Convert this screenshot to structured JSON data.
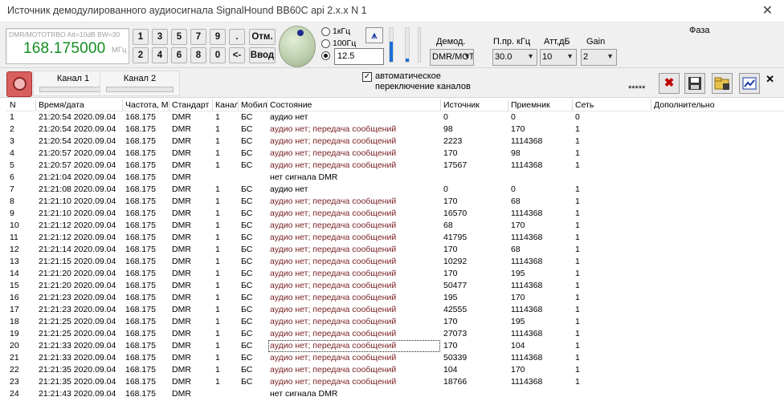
{
  "window": {
    "title": "Источник демодулированного аудиосигнала SignalHound BB60C api 2.x.x N 1",
    "close_glyph": "✕"
  },
  "frequency": {
    "mode_text": "DMR/MOTOTRBO Att=10dB BW=30",
    "value": "168.175000",
    "unit": "МГц"
  },
  "keypad": {
    "row1": [
      "1",
      "3",
      "5",
      "7",
      "9",
      "."
    ],
    "row2": [
      "2",
      "4",
      "6",
      "8",
      "0",
      "<-"
    ],
    "cancel": "Отм.",
    "enter": "Ввод"
  },
  "step": {
    "options": [
      "1кГц",
      "100Гц"
    ],
    "custom_value": "12.5",
    "selected": "custom"
  },
  "antenna_icon": "antenna-icon",
  "level_sliders": {
    "left_level": 0.6,
    "right_level": 0.1
  },
  "settings": {
    "demod_label": "Демод.",
    "demod_value": "DMR/MOTOTRBO",
    "bw_label": "П.пр. кГц",
    "bw_value": "30.0",
    "att_label": "Атт,дБ",
    "att_value": "10",
    "gain_label": "Gain",
    "gain_value": "2",
    "phase_label": "Фаза"
  },
  "channels": {
    "tabs": [
      "Канал 1",
      "Канал 2"
    ],
    "auto_switch_checked": true,
    "auto_switch_label_line1": "автоматическое",
    "auto_switch_label_line2": "переключение каналов",
    "stars": "*****",
    "close_glyph": "✕"
  },
  "table": {
    "columns": [
      "N",
      "Время/дата",
      "Частота, М",
      "Стандарт",
      "Канал",
      "Мобил",
      "Состояние",
      "Источник",
      "Приемник",
      "Сеть",
      "Дополнительно"
    ],
    "rows": [
      [
        "1",
        "21:20:54 2020.09.04",
        "168.175",
        "DMR",
        "1",
        "БС",
        "аудио нет",
        "0",
        "0",
        "0",
        ""
      ],
      [
        "2",
        "21:20:54 2020.09.04",
        "168.175",
        "DMR",
        "1",
        "БС",
        "аудио нет; передача сообщений",
        "98",
        "170",
        "1",
        ""
      ],
      [
        "3",
        "21:20:54 2020.09.04",
        "168.175",
        "DMR",
        "1",
        "БС",
        "аудио нет; передача сообщений",
        "2223",
        "1114368",
        "1",
        ""
      ],
      [
        "4",
        "21:20:57 2020.09.04",
        "168.175",
        "DMR",
        "1",
        "БС",
        "аудио нет; передача сообщений",
        "170",
        "98",
        "1",
        ""
      ],
      [
        "5",
        "21:20:57 2020.09.04",
        "168.175",
        "DMR",
        "1",
        "БС",
        "аудио нет; передача сообщений",
        "17567",
        "1114368",
        "1",
        ""
      ],
      [
        "6",
        "21:21:04 2020.09.04",
        "168.175",
        "DMR",
        "",
        "",
        "нет сигнала DMR",
        "",
        "",
        "",
        ""
      ],
      [
        "7",
        "21:21:08 2020.09.04",
        "168.175",
        "DMR",
        "1",
        "БС",
        "аудио нет",
        "0",
        "0",
        "1",
        ""
      ],
      [
        "8",
        "21:21:10 2020.09.04",
        "168.175",
        "DMR",
        "1",
        "БС",
        "аудио нет; передача сообщений",
        "170",
        "68",
        "1",
        ""
      ],
      [
        "9",
        "21:21:10 2020.09.04",
        "168.175",
        "DMR",
        "1",
        "БС",
        "аудио нет; передача сообщений",
        "16570",
        "1114368",
        "1",
        ""
      ],
      [
        "10",
        "21:21:12 2020.09.04",
        "168.175",
        "DMR",
        "1",
        "БС",
        "аудио нет; передача сообщений",
        "68",
        "170",
        "1",
        ""
      ],
      [
        "11",
        "21:21:12 2020.09.04",
        "168.175",
        "DMR",
        "1",
        "БС",
        "аудио нет; передача сообщений",
        "41795",
        "1114368",
        "1",
        ""
      ],
      [
        "12",
        "21:21:14 2020.09.04",
        "168.175",
        "DMR",
        "1",
        "БС",
        "аудио нет; передача сообщений",
        "170",
        "68",
        "1",
        ""
      ],
      [
        "13",
        "21:21:15 2020.09.04",
        "168.175",
        "DMR",
        "1",
        "БС",
        "аудио нет; передача сообщений",
        "10292",
        "1114368",
        "1",
        ""
      ],
      [
        "14",
        "21:21:20 2020.09.04",
        "168.175",
        "DMR",
        "1",
        "БС",
        "аудио нет; передача сообщений",
        "170",
        "195",
        "1",
        ""
      ],
      [
        "15",
        "21:21:20 2020.09.04",
        "168.175",
        "DMR",
        "1",
        "БС",
        "аудио нет; передача сообщений",
        "50477",
        "1114368",
        "1",
        ""
      ],
      [
        "16",
        "21:21:23 2020.09.04",
        "168.175",
        "DMR",
        "1",
        "БС",
        "аудио нет; передача сообщений",
        "195",
        "170",
        "1",
        ""
      ],
      [
        "17",
        "21:21:23 2020.09.04",
        "168.175",
        "DMR",
        "1",
        "БС",
        "аудио нет; передача сообщений",
        "42555",
        "1114368",
        "1",
        ""
      ],
      [
        "18",
        "21:21:25 2020.09.04",
        "168.175",
        "DMR",
        "1",
        "БС",
        "аудио нет; передача сообщений",
        "170",
        "195",
        "1",
        ""
      ],
      [
        "19",
        "21:21:25 2020.09.04",
        "168.175",
        "DMR",
        "1",
        "БС",
        "аудио нет; передача сообщений",
        "27073",
        "1114368",
        "1",
        ""
      ],
      [
        "20",
        "21:21:33 2020.09.04",
        "168.175",
        "DMR",
        "1",
        "БС",
        "аудио нет; передача сообщений",
        "170",
        "104",
        "1",
        ""
      ],
      [
        "21",
        "21:21:33 2020.09.04",
        "168.175",
        "DMR",
        "1",
        "БС",
        "аудио нет; передача сообщений",
        "50339",
        "1114368",
        "1",
        ""
      ],
      [
        "22",
        "21:21:35 2020.09.04",
        "168.175",
        "DMR",
        "1",
        "БС",
        "аудио нет; передача сообщений",
        "104",
        "170",
        "1",
        ""
      ],
      [
        "23",
        "21:21:35 2020.09.04",
        "168.175",
        "DMR",
        "1",
        "БС",
        "аудио нет; передача сообщений",
        "18766",
        "1114368",
        "1",
        ""
      ],
      [
        "24",
        "21:21:43 2020.09.04",
        "168.175",
        "DMR",
        "",
        "",
        "нет сигнала DMR",
        "",
        "",
        "",
        ""
      ]
    ],
    "selected_row": 19,
    "message_color": "#7a1f1f"
  }
}
